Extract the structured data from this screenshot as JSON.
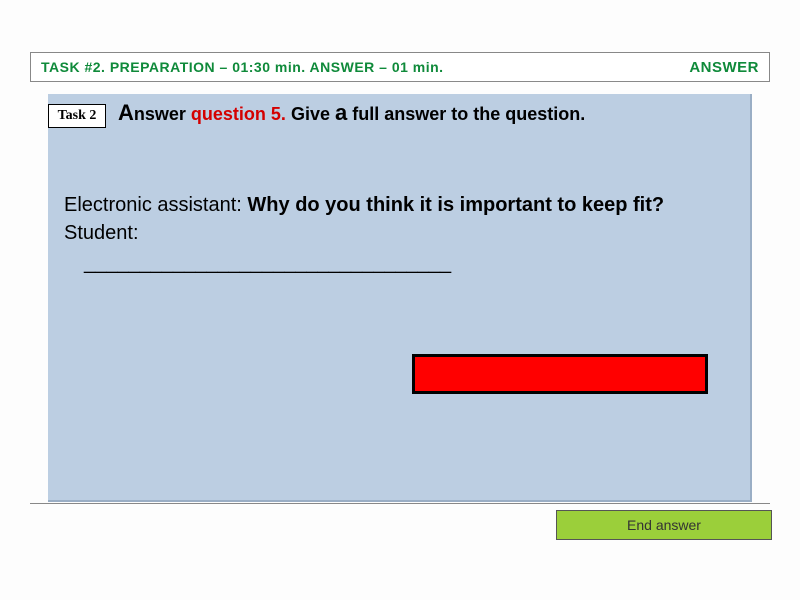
{
  "header": {
    "left": "TASK #2. PREPARATION – 01:30 min. ANSWER – 01 min.",
    "right": "ANSWER"
  },
  "task_badge": "Task 2",
  "instruction": {
    "cap_A": "A",
    "part1": "nswer  ",
    "red": "question 5.",
    "part2": " Give ",
    "cap_a2": "a",
    "part3": "  full answer to the question."
  },
  "question": {
    "label": "Electronic assistant: ",
    "text": "Why do you think it is important to keep fit?"
  },
  "student_label": "Student:",
  "blank": "_________________________________",
  "end_answer": "End answer"
}
